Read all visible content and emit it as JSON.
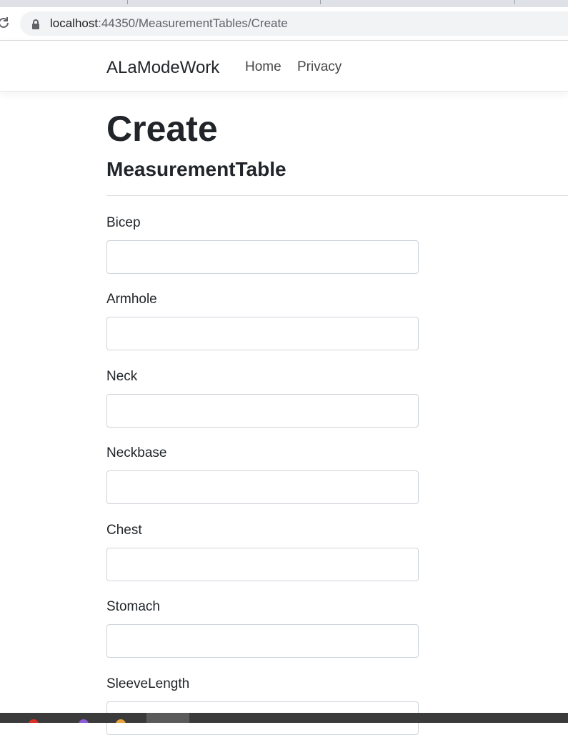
{
  "browser": {
    "url_host": "localhost",
    "url_rest": ":44350/MeasurementTables/Create",
    "reload_icon": "reload-icon",
    "lock_icon": "lock-icon"
  },
  "navbar": {
    "brand": "ALaModeWork",
    "links": [
      "Home",
      "Privacy"
    ]
  },
  "page": {
    "title": "Create",
    "subtitle": "MeasurementTable"
  },
  "form": {
    "fields": [
      {
        "label": "Bicep",
        "value": ""
      },
      {
        "label": "Armhole",
        "value": ""
      },
      {
        "label": "Neck",
        "value": ""
      },
      {
        "label": "Neckbase",
        "value": ""
      },
      {
        "label": "Chest",
        "value": ""
      },
      {
        "label": "Stomach",
        "value": ""
      },
      {
        "label": "SleeveLength",
        "value": ""
      }
    ]
  }
}
